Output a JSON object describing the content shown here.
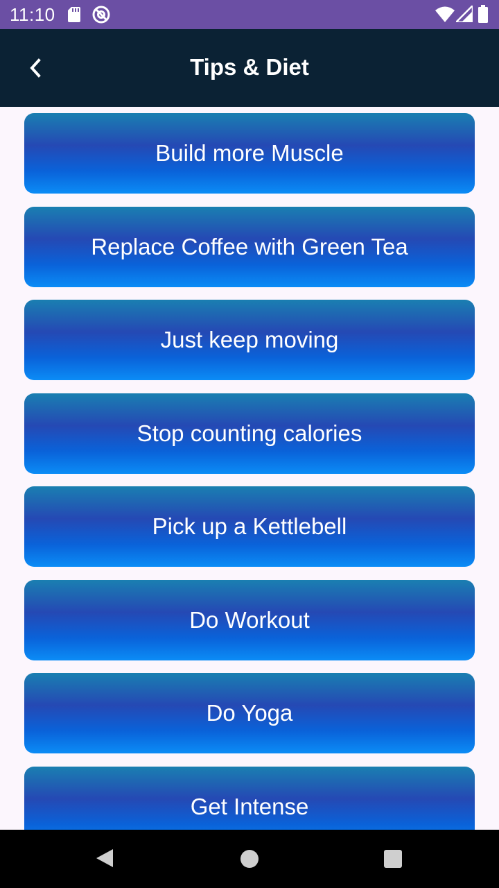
{
  "status_bar": {
    "time": "11:10",
    "icons": [
      "sd-card-icon",
      "at-sign-icon",
      "wifi-icon",
      "signal-icon",
      "battery-icon"
    ]
  },
  "toolbar": {
    "back_icon": "chevron-left-icon",
    "title": "Tips & Diet"
  },
  "tips": [
    {
      "label": "Build more Muscle"
    },
    {
      "label": "Replace Coffee with Green Tea"
    },
    {
      "label": "Just keep moving"
    },
    {
      "label": "Stop counting calories"
    },
    {
      "label": "Pick up a Kettlebell"
    },
    {
      "label": "Do Workout"
    },
    {
      "label": "Do Yoga"
    },
    {
      "label": "Get Intense"
    }
  ],
  "colors": {
    "status_bar": "#6b4fa4",
    "toolbar": "#0b2234",
    "background": "#fcf6fd",
    "button_gradient_top": "#1a7fb1",
    "button_gradient_mid": "#2549b4",
    "button_gradient_bottom": "#0b8cf6"
  },
  "nav_bar": {
    "icons": [
      "nav-back-icon",
      "nav-home-icon",
      "nav-recents-icon"
    ]
  }
}
